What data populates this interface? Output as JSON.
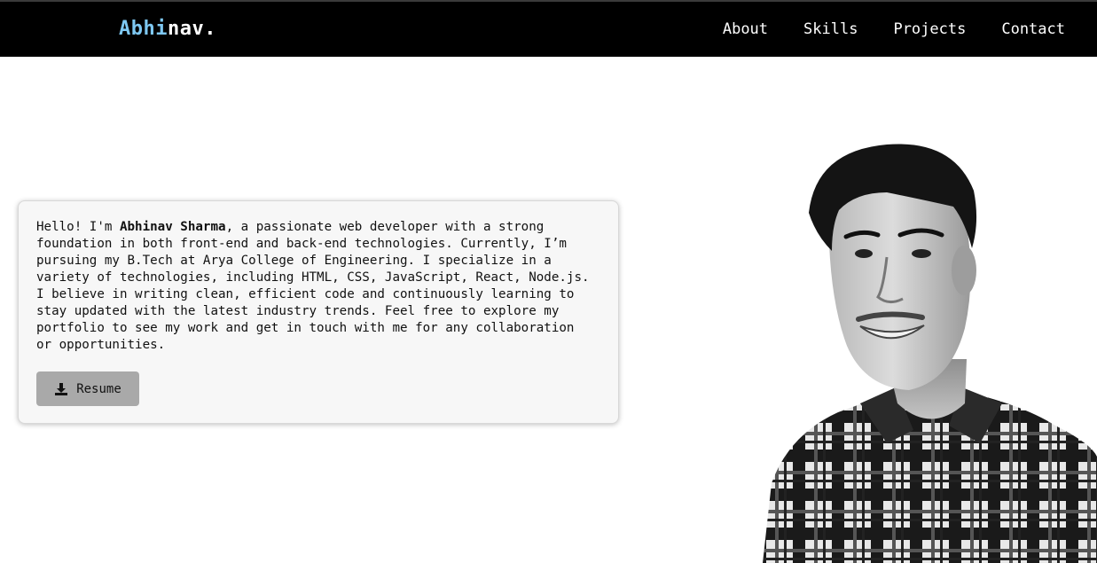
{
  "navbar": {
    "logo_part1": "Abhi",
    "logo_part2": "nav.",
    "links": [
      {
        "label": "About"
      },
      {
        "label": "Skills"
      },
      {
        "label": "Projects"
      },
      {
        "label": "Contact"
      }
    ]
  },
  "intro": {
    "greeting": "Hello! I'm ",
    "name": "Abhinav Sharma",
    "body": ", a passionate web developer with a strong foundation in both front-end and back-end technologies. Currently, I’m pursuing my B.Tech at Arya College of Engineering. I specialize in a variety of technologies, including HTML, CSS, JavaScript, React, Node.js. I believe in writing clean, efficient code and continuously learning to stay updated with the latest industry trends. Feel free to explore my portfolio to see my work and get in touch with me for any collaboration or opportunities.",
    "resume_label": "Resume",
    "resume_icon": "download-icon"
  },
  "colors": {
    "nav_bg": "#000000",
    "logo_accent": "#7ec8f2",
    "card_bg": "#f7f7f7",
    "button_bg": "#a9a9a9"
  }
}
